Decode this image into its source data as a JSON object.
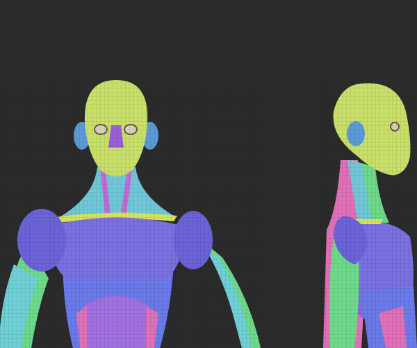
{
  "scene": {
    "colors": {
      "background": "#2b2b2b",
      "head": "#c8e06a",
      "ear": "#5b9bd5",
      "nose": "#9a5fd6",
      "neck": "#6fc7d8",
      "neck_stripe": "#c46ad8",
      "collar": "#d6e35a",
      "shoulder": "#6b63d8",
      "chest": "#7a70e0",
      "abdomen": "#6a7ae8",
      "arm_green": "#6fd98a",
      "arm_cyan": "#6fd0d6",
      "lower_purple": "#a070e0",
      "lower_pink": "#e070b8"
    }
  }
}
